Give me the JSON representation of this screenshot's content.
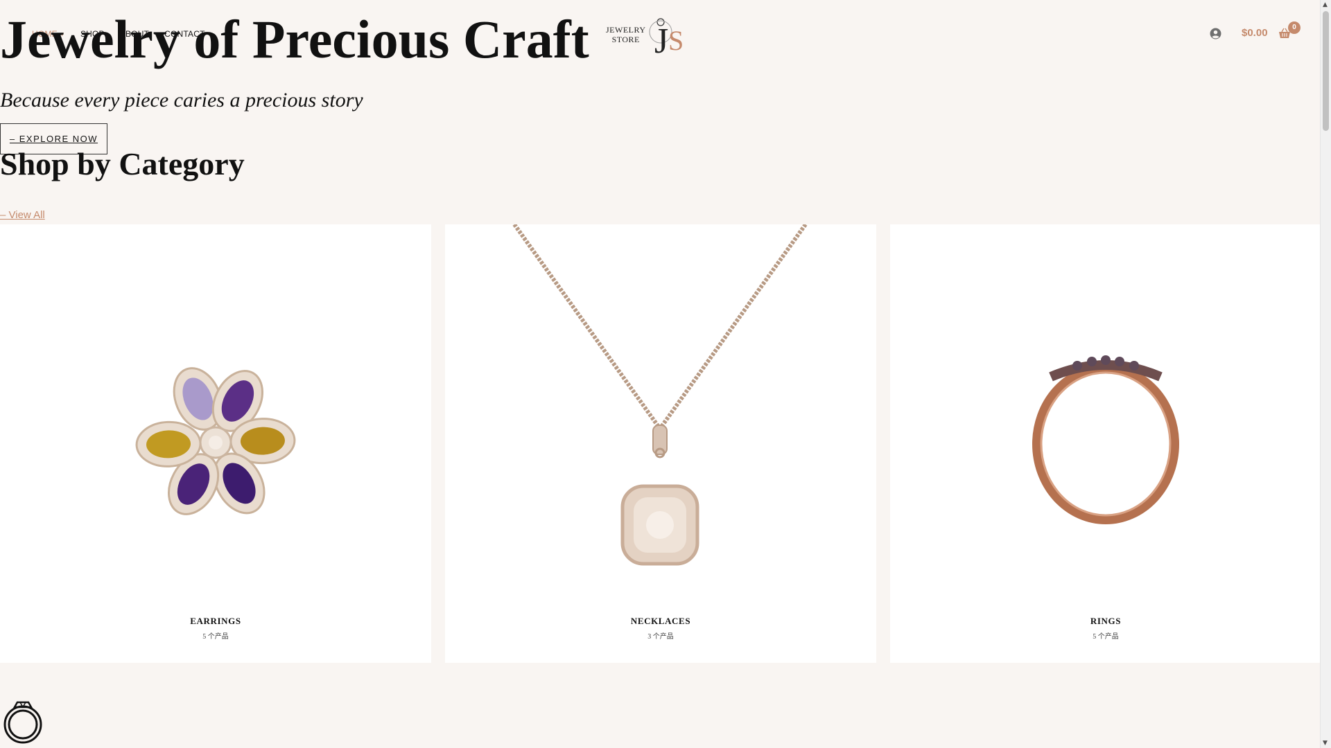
{
  "header": {
    "nav": [
      {
        "label": "HOME",
        "active": true,
        "has_dropdown": true
      },
      {
        "label": "SHOP",
        "active": false,
        "has_dropdown": false
      },
      {
        "label": "ABOUT",
        "active": false,
        "has_dropdown": false
      },
      {
        "label": "CONTACT",
        "active": false,
        "has_dropdown": false
      }
    ],
    "logo": {
      "line1": "JEWELRY",
      "line2": "STORE",
      "monogram_j": "J",
      "monogram_s": "S"
    },
    "cart": {
      "total": "$0.00",
      "count": "0"
    }
  },
  "hero": {
    "title": "Jewelry of Precious Craft",
    "subtitle": "Because every piece caries a precious story",
    "cta": "– EXPLORE NOW"
  },
  "categories_section": {
    "title": "Shop by Category",
    "view_all": "– View All",
    "items": [
      {
        "name": "EARRINGS",
        "count": "5 个产品",
        "icon": "flower-earring-image"
      },
      {
        "name": "NECKLACES",
        "count": "3 个产品",
        "icon": "pendant-necklace-image"
      },
      {
        "name": "RINGS",
        "count": "5 个产品",
        "icon": "band-ring-image"
      }
    ]
  },
  "colors": {
    "accent": "#c58a6c",
    "background": "#f9f5f2",
    "card": "#ffffff",
    "text": "#111111"
  }
}
